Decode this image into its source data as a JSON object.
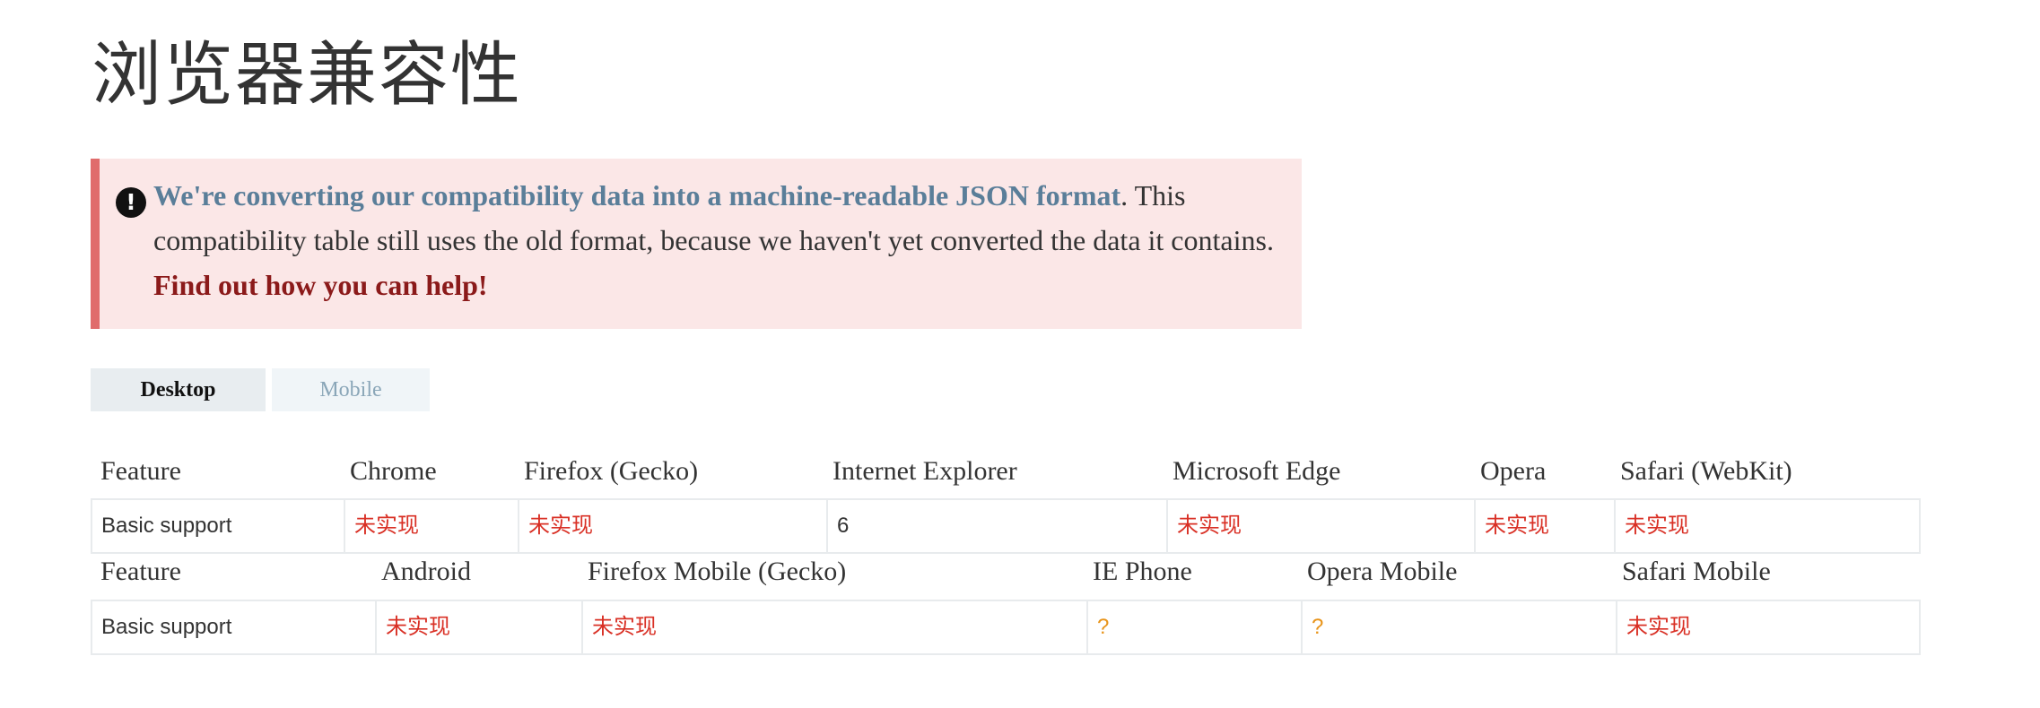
{
  "page": {
    "title": "浏览器兼容性"
  },
  "notice": {
    "icon": "exclamation-circle-icon",
    "link_text": "We're converting our compatibility data into a machine-readable JSON format",
    "body_text": ". This compatibility table still uses the old format, because we haven't yet converted the data it contains. ",
    "help_text": "Find out how you can help!"
  },
  "tabs": [
    {
      "label": "Desktop",
      "selected": true
    },
    {
      "label": "Mobile",
      "selected": false
    }
  ],
  "desktop_table": {
    "headers": [
      "Feature",
      "Chrome",
      "Firefox (Gecko)",
      "Internet Explorer",
      "Microsoft Edge",
      "Opera",
      "Safari (WebKit)"
    ],
    "rows": [
      {
        "cells": [
          "Basic support",
          "未实现",
          "未实现",
          "6",
          "未实现",
          "未实现",
          "未实现"
        ]
      }
    ]
  },
  "mobile_table": {
    "headers": [
      "Feature",
      "Android",
      "Firefox Mobile (Gecko)",
      "IE Phone",
      "Opera Mobile",
      "Safari Mobile"
    ],
    "rows": [
      {
        "cells": [
          "Basic support",
          "未实现",
          "未实现",
          "?",
          "?",
          "未实现"
        ]
      }
    ]
  },
  "colors": {
    "unsupported": "#d93025",
    "unknown": "#e8941a",
    "notice_bg": "#fbe7e7",
    "notice_border": "#e06c6c",
    "link": "#5a7e99",
    "help_link": "#8b1a1a"
  }
}
